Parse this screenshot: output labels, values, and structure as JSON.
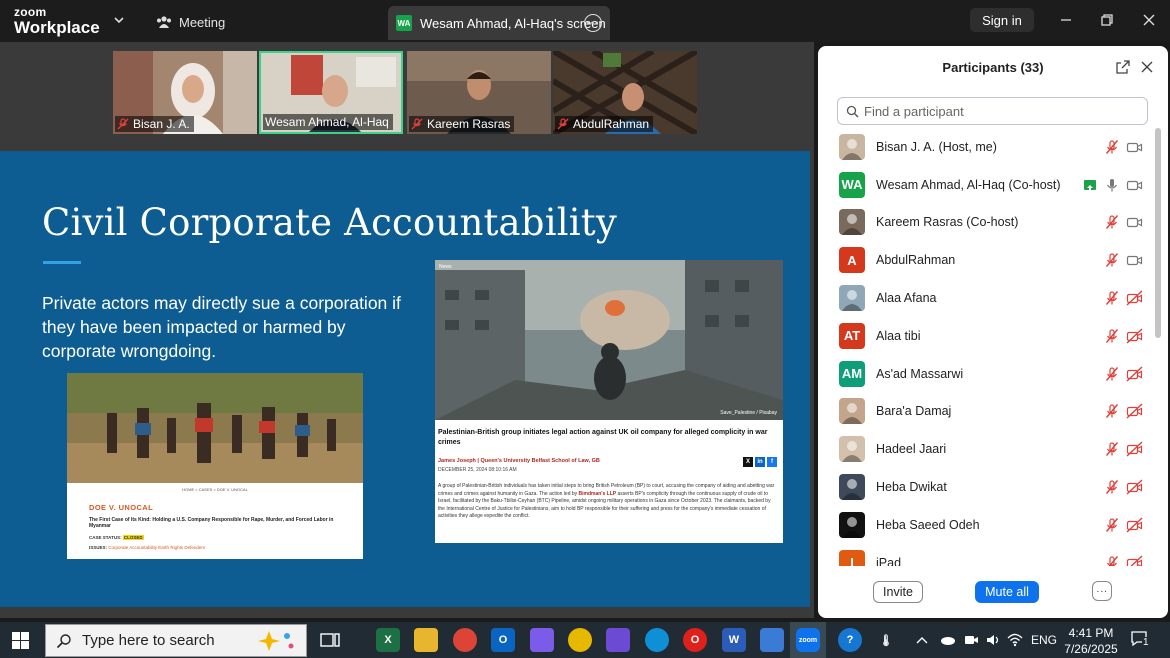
{
  "app": {
    "logo_top": "zoom",
    "logo_bottom": "Workplace"
  },
  "toolbar": {
    "meeting_label": "Meeting",
    "share_badge": "WA",
    "share_tab_label": "Wesam Ahmad, Al-Haq's screen",
    "signin_label": "Sign in"
  },
  "thumbnails": [
    {
      "name": "Bisan J. A."
    },
    {
      "name": "Wesam Ahmad, Al-Haq"
    },
    {
      "name": "Kareem Rasras"
    },
    {
      "name": "AbdulRahman"
    }
  ],
  "slide": {
    "title": "Civil Corporate Accountability",
    "body": "Private actors may directly sue a corporation if they have been impacted or harmed by corporate wrongdoing.",
    "doe_card": {
      "nav": "HOME > CASES > DOE V. UNOCAL",
      "title": "DOE V. UNOCAL",
      "subtitle": "The First Case of Its Kind: Holding a U.S. Company Responsible for Rape, Murder, and Forced Labor in Myanmar",
      "status_label": "CASE STATUS:",
      "status_value": "CLOSED",
      "issues_label": "ISSUES:",
      "issues_value": "Corporate Accountability Earth Rights Defenders"
    },
    "news_card": {
      "tag": "News",
      "credit": "Save_Palestine / Pixabay",
      "headline": "Palestinian-British group initiates legal action against UK oil company for alleged complicity in war crimes",
      "author": "James Joseph | Queen's University Belfast School of Law, GB",
      "date": "DECEMBER 25, 2024 08:10:16 AM",
      "social": [
        "X",
        "in",
        "f"
      ],
      "text_before": "A group of Palestinian-British individuals has taken initial steps to bring British Petroleum (BP) to court, accusing the company of aiding and abetting war crimes and crimes against humanity in Gaza. The action led by",
      "text_firm": "Bimdman's LLP",
      "text_after": "asserts BP's complicity through the continuous supply of crude oil to Israel, facilitated by the Baku-Tbilisi-Ceyhan (BTC) Pipeline, amidst ongoing military operations in Gaza since October 2023. The claimants, backed by the International Centre of Justice for Palestinians, aim to hold BP responsible for their suffering and press for the company's immediate cessation of activities they allege expedite the conflict."
    }
  },
  "participants_panel": {
    "title": "Participants (33)",
    "search_placeholder": "Find a participant",
    "invite_label": "Invite",
    "mute_all_label": "Mute all",
    "more_label": "···",
    "participants": [
      {
        "name": "Bisan J. A. (Host, me)",
        "avatar": "photo",
        "color": "#c9b6a0",
        "mic": "muted",
        "video": "on"
      },
      {
        "name": "Wesam Ahmad, Al-Haq (Co-host)",
        "avatar": "WA",
        "color": "#17a34a",
        "mic": "on",
        "video": "on",
        "sharing": true
      },
      {
        "name": "Kareem Rasras (Co-host)",
        "avatar": "photo",
        "color": "#7a6a5e",
        "mic": "muted",
        "video": "on"
      },
      {
        "name": "AbdulRahman",
        "avatar": "A",
        "color": "#d4381d",
        "mic": "muted",
        "video": "on"
      },
      {
        "name": "Alaa Afana",
        "avatar": "photo",
        "color": "#8fa7b6",
        "mic": "muted",
        "video": "off"
      },
      {
        "name": "Alaa tibi",
        "avatar": "AT",
        "color": "#d4381d",
        "mic": "muted",
        "video": "off"
      },
      {
        "name": "As'ad Massarwi",
        "avatar": "AM",
        "color": "#0f9e7a",
        "mic": "muted",
        "video": "off"
      },
      {
        "name": "Bara'a Damaj",
        "avatar": "photo",
        "color": "#c3a58c",
        "mic": "muted",
        "video": "off"
      },
      {
        "name": "Hadeel Jaari",
        "avatar": "photo",
        "color": "#d2c0ac",
        "mic": "muted",
        "video": "off"
      },
      {
        "name": "Heba Dwikat",
        "avatar": "photo",
        "color": "#3e4a5a",
        "mic": "muted",
        "video": "off"
      },
      {
        "name": "Heba Saeed Odeh",
        "avatar": "photo",
        "color": "#111111",
        "mic": "muted",
        "video": "off"
      },
      {
        "name": "iPad",
        "avatar": "I",
        "color": "#e05a10",
        "mic": "muted",
        "video": "off"
      }
    ]
  },
  "taskbar": {
    "search_placeholder": "Type here to search",
    "lang": "ENG",
    "time": "4:41 PM",
    "date": "7/26/2025",
    "notifications": "1",
    "apps": [
      "task-view",
      "excel",
      "file-explorer",
      "chrome-profile",
      "outlook",
      "copilot",
      "chrome",
      "m365",
      "edge",
      "opera",
      "word",
      "store",
      "zoom"
    ]
  },
  "colors": {
    "slide_bg": "#0d5d92",
    "accent": "#2fa3e6",
    "zoom_blue": "#0e72ed",
    "active_speaker": "#3cd28a",
    "muted_red": "#e0403a"
  }
}
